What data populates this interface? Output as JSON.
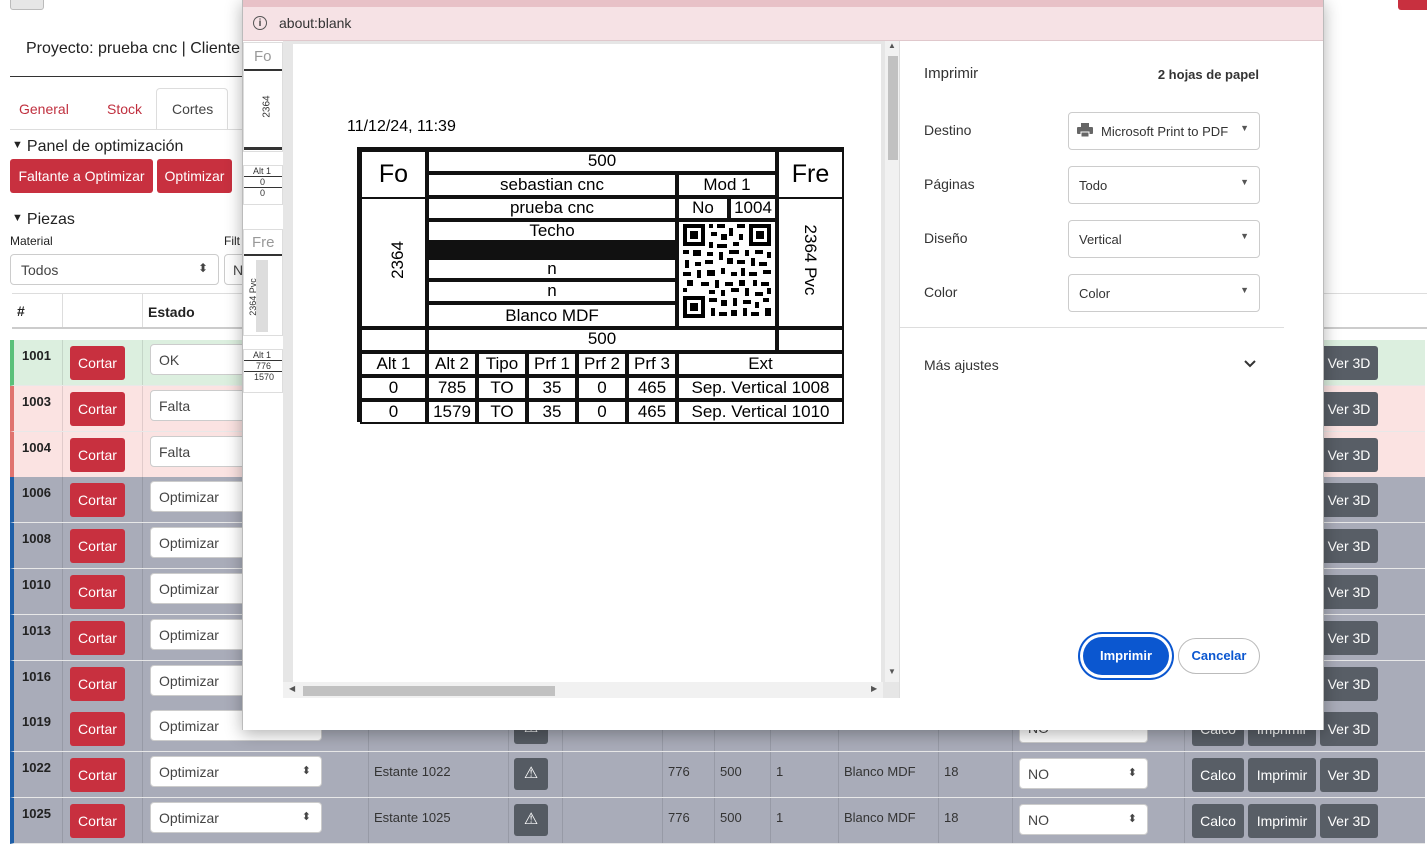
{
  "app": {
    "project_title": "Proyecto: prueba cnc | Cliente",
    "tabs": [
      "General",
      "Stock",
      "Cortes"
    ],
    "panel_title": "Panel de optimización",
    "btn_faltante": "Faltante a Optimizar",
    "btn_optimizar": "Optimizar",
    "piezas_title": "Piezas",
    "material_label": "Material",
    "filter_label": "Filt",
    "material_value": "Todos",
    "filter_value": "N",
    "header_num": "#",
    "header_estado": "Estado"
  },
  "rows": [
    {
      "id": "1001",
      "btn": "Cortar",
      "estado": "OK",
      "status_color": "#dcefdf",
      "desc": "",
      "v1": "",
      "v2": "",
      "v3": "",
      "mat": "",
      "th": "",
      "no": "",
      "calco": "",
      "imprimir": "",
      "ver": "Ver 3D"
    },
    {
      "id": "1003",
      "btn": "Cortar",
      "estado": "Falta",
      "status_color": "#fbe3e2",
      "desc": "",
      "v1": "",
      "v2": "",
      "v3": "",
      "mat": "",
      "th": "",
      "no": "",
      "calco": "",
      "imprimir": "",
      "ver": "Ver 3D"
    },
    {
      "id": "1004",
      "btn": "Cortar",
      "estado": "Falta",
      "status_color": "#fbe3e2",
      "desc": "",
      "v1": "",
      "v2": "",
      "v3": "",
      "mat": "",
      "th": "",
      "no": "",
      "calco": "",
      "imprimir": "",
      "ver": "Ver 3D"
    },
    {
      "id": "1006",
      "btn": "Cortar",
      "estado": "Optimizar",
      "status_color": "#a9acb9",
      "desc": "",
      "v1": "",
      "v2": "",
      "v3": "",
      "mat": "",
      "th": "",
      "no": "",
      "calco": "",
      "imprimir": "",
      "ver": "Ver 3D"
    },
    {
      "id": "1008",
      "btn": "Cortar",
      "estado": "Optimizar",
      "status_color": "#a9acb9",
      "desc": "",
      "v1": "",
      "v2": "",
      "v3": "",
      "mat": "",
      "th": "",
      "no": "",
      "calco": "",
      "imprimir": "",
      "ver": "Ver 3D"
    },
    {
      "id": "1010",
      "btn": "Cortar",
      "estado": "Optimizar",
      "status_color": "#a9acb9",
      "desc": "",
      "v1": "",
      "v2": "",
      "v3": "",
      "mat": "",
      "th": "",
      "no": "",
      "calco": "",
      "imprimir": "",
      "ver": "Ver 3D"
    },
    {
      "id": "1013",
      "btn": "Cortar",
      "estado": "Optimizar",
      "status_color": "#a9acb9",
      "desc": "",
      "v1": "",
      "v2": "",
      "v3": "",
      "mat": "",
      "th": "",
      "no": "",
      "calco": "",
      "imprimir": "",
      "ver": "Ver 3D"
    },
    {
      "id": "1016",
      "btn": "Cortar",
      "estado": "Optimizar",
      "status_color": "#a9acb9",
      "desc": "",
      "v1": "",
      "v2": "",
      "v3": "",
      "mat": "",
      "th": "",
      "no": "",
      "calco": "",
      "imprimir": "",
      "ver": "Ver 3D"
    },
    {
      "id": "1019",
      "btn": "Cortar",
      "estado": "Optimizar",
      "status_color": "#a9acb9",
      "desc": "",
      "v1": "",
      "v2": "",
      "v3": "",
      "mat": "",
      "th": "",
      "no": "NO",
      "calco": "Calco",
      "imprimir": "Imprimir",
      "ver": "Ver 3D"
    },
    {
      "id": "1022",
      "btn": "Cortar",
      "estado": "Optimizar",
      "status_color": "#a9acb9",
      "desc": "Estante 1022",
      "v1": "776",
      "v2": "500",
      "v3": "1",
      "mat": "Blanco MDF",
      "th": "18",
      "no": "NO",
      "calco": "Calco",
      "imprimir": "Imprimir",
      "ver": "Ver 3D"
    },
    {
      "id": "1025",
      "btn": "Cortar",
      "estado": "Optimizar",
      "status_color": "#a9acb9",
      "desc": "Estante 1025",
      "v1": "776",
      "v2": "500",
      "v3": "1",
      "mat": "Blanco MDF",
      "th": "18",
      "no": "NO",
      "calco": "Calco",
      "imprimir": "Imprimir",
      "ver": "Ver 3D"
    }
  ],
  "dialog": {
    "url": "about:blank",
    "thumb": {
      "fo": "Fo",
      "num": "2364",
      "alt": "Alt 1",
      "z1": "0",
      "z2": "0",
      "fre": "Fre",
      "pvc": "2364 Pvc",
      "alt2": "Alt 1",
      "v776": "776",
      "v1570": "1570"
    },
    "preview": {
      "date": "11/12/24, 11:39",
      "fo": "Fo",
      "fre": "Fre",
      "top_width": "500",
      "client": "sebastian cnc",
      "mod": "Mod 1",
      "project": "prueba cnc",
      "no_label": "No",
      "no_value": "1004",
      "piece": "Techo",
      "n1": "n",
      "n2": "n",
      "material": "Blanco MDF",
      "side_left": "2364",
      "side_right": "2364 Pvc",
      "bottom_width": "500",
      "headers": [
        "Alt 1",
        "Alt 2",
        "Tipo",
        "Prf 1",
        "Prf 2",
        "Prf 3",
        "Ext"
      ],
      "rows": [
        [
          "0",
          "785",
          "TO",
          "35",
          "0",
          "465",
          "Sep. Vertical 1008"
        ],
        [
          "0",
          "1579",
          "TO",
          "35",
          "0",
          "465",
          "Sep. Vertical 1010"
        ]
      ]
    },
    "settings": {
      "title": "Imprimir",
      "sheets": "2 hojas de papel",
      "destino_label": "Destino",
      "destino_value": "Microsoft Print to PDF",
      "paginas_label": "Páginas",
      "paginas_value": "Todo",
      "diseno_label": "Diseño",
      "diseno_value": "Vertical",
      "color_label": "Color",
      "color_value": "Color",
      "mas_ajustes": "Más ajustes",
      "print_button": "Imprimir",
      "cancel_button": "Cancelar"
    }
  }
}
